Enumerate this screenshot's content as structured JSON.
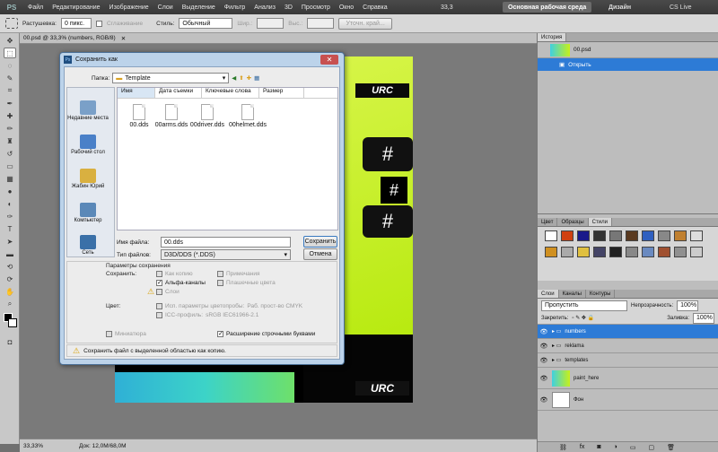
{
  "menubar": {
    "logo": "PS",
    "items": [
      "Файл",
      "Редактирование",
      "Изображение",
      "Слои",
      "Выделение",
      "Фильтр",
      "Анализ",
      "3D",
      "Просмотр",
      "Окно",
      "Справка"
    ],
    "zoom": "33,3",
    "workspace": "Основная рабочая среда",
    "design": "Дизайн",
    "cslive": "CS Live"
  },
  "options": {
    "feather_label": "Растушевка:",
    "feather_value": "0 пикс.",
    "antialias": "Сглаживание",
    "style_label": "Стиль:",
    "style_value": "Обычный",
    "width_label": "Шир.:",
    "height_label": "Выс.:",
    "refine": "Уточн. край..."
  },
  "doc": {
    "tab": "00.psd @ 33,3% (numbers, RGB/8)",
    "status_zoom": "33,33%",
    "status_doc": "Док: 12,0M/68,0M"
  },
  "dialog": {
    "title": "Сохранить как",
    "folder_label": "Папка:",
    "folder_value": "Template",
    "columns": [
      "Имя",
      "Дата съемки",
      "Ключевые слова",
      "Размер"
    ],
    "places": [
      "Недавние места",
      "Рабочий стол",
      "Жабин Юрий",
      "Компьютер",
      "Сеть"
    ],
    "files": [
      "00.dds",
      "00arms.dds",
      "00driver.dds",
      "00helmet.dds"
    ],
    "filename_label": "Имя файла:",
    "filename_value": "00.dds",
    "filetype_label": "Тип файлов:",
    "filetype_value": "D3D/DDS (*.DDS)",
    "save_button": "Сохранить",
    "cancel_button": "Отмена",
    "save_params": "Параметры сохранения",
    "save_label": "Сохранить:",
    "as_copy": "Как копию",
    "notes": "Примечания",
    "alpha": "Альфа-каналы",
    "spot": "Плашечные цвета",
    "layers": "Слои",
    "color_label": "Цвет:",
    "proof": "Исп. параметры цветопробы:",
    "proof_value": "Раб. прост-во CMYK",
    "icc": "ICC-профиль:",
    "icc_value": "sRGB IEC61966-2.1",
    "thumb": "Миниатюра",
    "ext": "Расширение строчными буквами",
    "warning": "Сохранить файл с выделенной областью как копию."
  },
  "history": {
    "tab": "История",
    "snapshot": "00.psd",
    "state": "Открыть"
  },
  "styles": {
    "tabs": [
      "Цвет",
      "Образцы",
      "Стили"
    ]
  },
  "layers": {
    "tabs": [
      "Слои",
      "Каналы",
      "Контуры"
    ],
    "blend": "Пропустить",
    "opacity_label": "Непрозрачность:",
    "opacity_value": "100%",
    "lock_label": "Закрепить:",
    "fill_label": "Заливка:",
    "fill_value": "100%",
    "items": [
      "numbers",
      "reklama",
      "templates",
      "paint_here",
      "Фон"
    ]
  },
  "colors": {
    "accent": "#2d7bd6",
    "lime": "#c6f01a",
    "cyan": "#3fd0e0"
  }
}
